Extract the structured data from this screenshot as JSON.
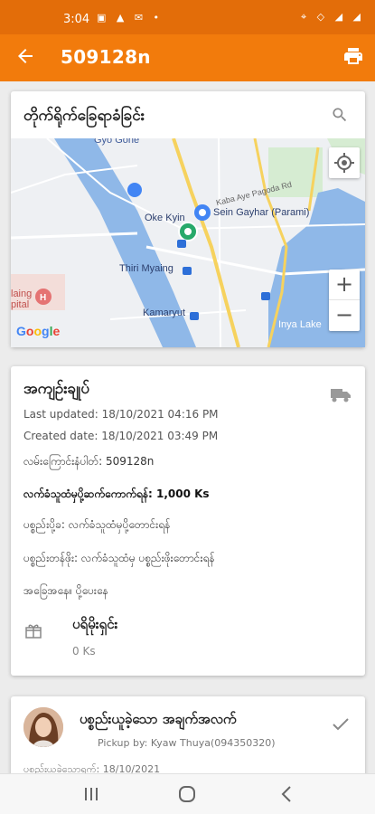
{
  "status_bar": {
    "time": "3:04"
  },
  "app_bar": {
    "title": "509128n"
  },
  "map_card": {
    "title": "တိုက်ရိုက်ခြေရာခံခြင်း",
    "labels": {
      "gyo_gone": "Gyo Gone",
      "kaba_aye": "Kaba Aye Pagoda Rd",
      "oke_kyin": "Oke Kyin",
      "sein_gayhar": "Sein Gayhar (Parami)",
      "thiri_myaing": "Thiri Myaing",
      "kamaryut": "Kamaryut",
      "inya_lake": "Inya Lake",
      "hospital": "laing\npital",
      "google": "Google"
    }
  },
  "summary_card": {
    "title": "အကျဉ်းချုပ်",
    "last_updated": "Last updated: 18/10/2021 04:16 PM",
    "created_date": "Created date: 18/10/2021 03:49 PM",
    "waybill": "လမ်းကြောင်းနံပါတ်: 509128n",
    "fee": "လက်ခံသူထံမှပို့ဆက်ကောက်ရန်: 1,000 Ks",
    "sender": "ပစ္စည်းပို့ခ: လက်ခံသူထံမှပို့တောင်းရန်",
    "item_type": "ပစ္စည်းတန်ဖိုး: လက်ခံသူထံမှ ပစ္စည်းဖိုးတောင်းရန်",
    "status": "အခြေအနေ။ ပို့ပေးနေ",
    "product_name": "ပရိမိုးရှင်း",
    "product_price": "0 Ks"
  },
  "pickup_card": {
    "title": "ပစ္စည်းယူခဲ့သော အချက်အလက်",
    "pickup_by": "Pickup by: Kyaw Thuya(094350320)",
    "date_cut": "ပစ္စည်းယူခဲ့သောရက်: 18/10/2021"
  },
  "colors": {
    "status_bar": "#e36d09",
    "app_bar": "#f27b0c",
    "map_water": "#8fb8e8",
    "map_road": "#f6d25e"
  }
}
